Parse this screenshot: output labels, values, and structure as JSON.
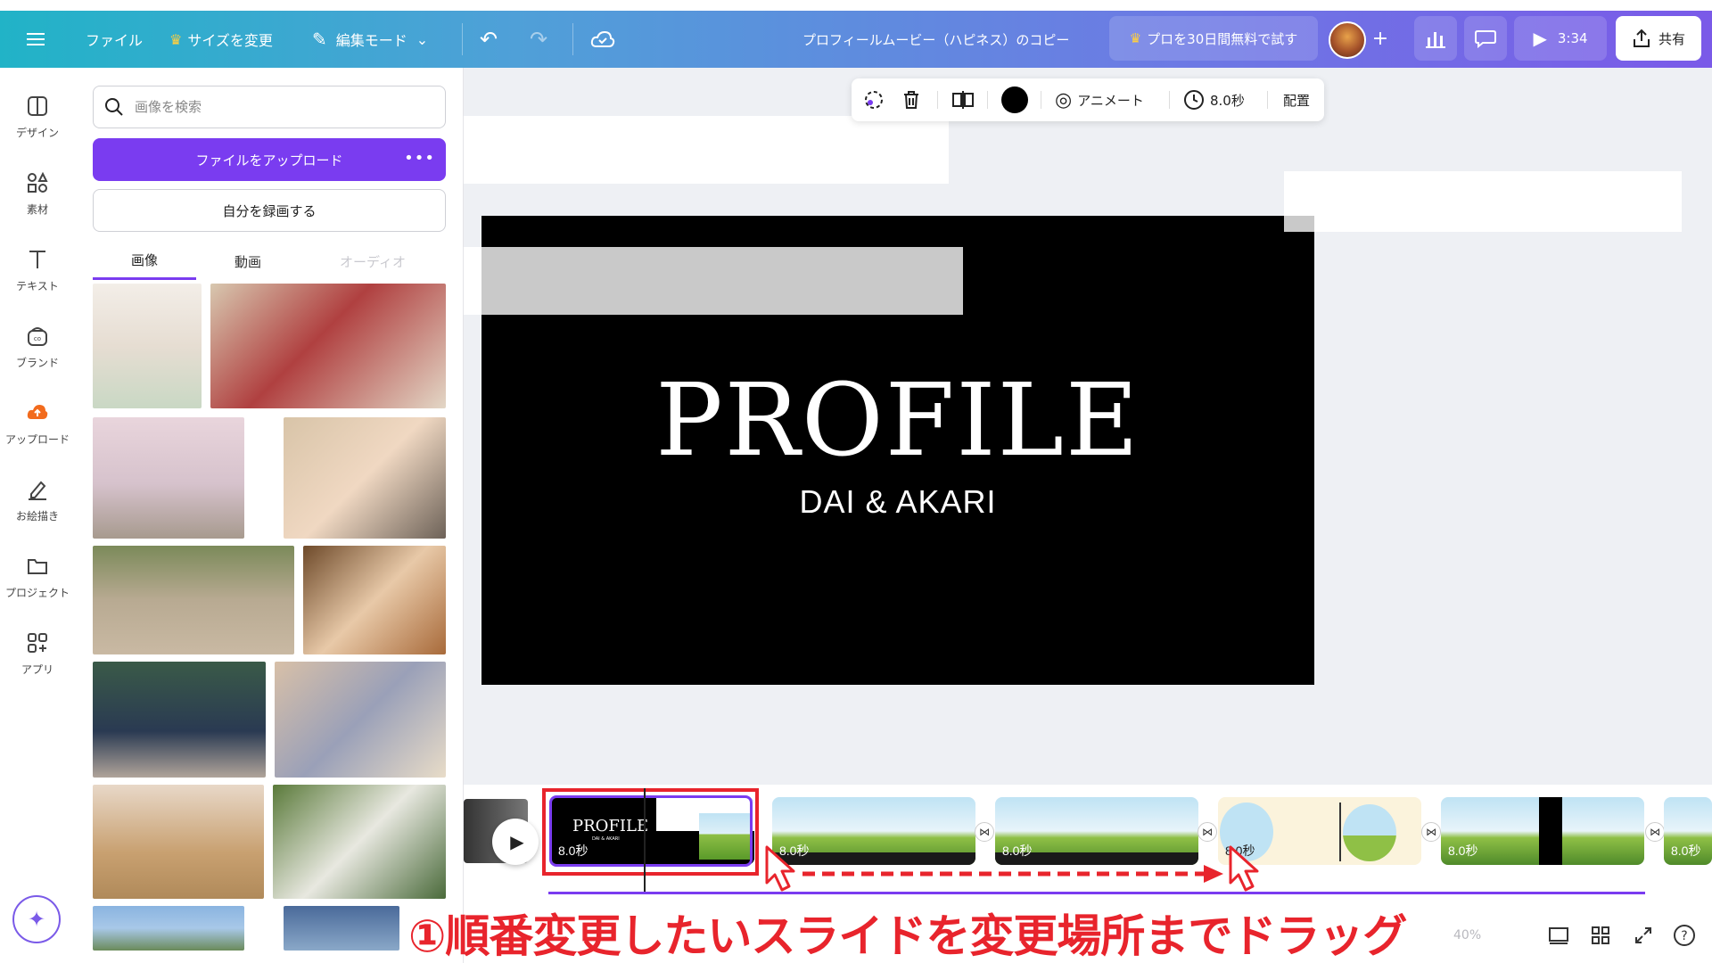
{
  "topbar": {
    "file": "ファイル",
    "resize": "サイズを変更",
    "edit_mode": "編集モード",
    "doc_title": "プロフィールムービー（ハピネス）のコピー",
    "pro_trial": "プロを30日間無料で試す",
    "play_time": "3:34",
    "share": "共有",
    "add": "+"
  },
  "rail": {
    "items": [
      {
        "label": "デザイン",
        "icon": "layout-icon"
      },
      {
        "label": "素材",
        "icon": "elements-icon"
      },
      {
        "label": "テキスト",
        "icon": "text-icon"
      },
      {
        "label": "ブランド",
        "icon": "brand-icon"
      },
      {
        "label": "アップロード",
        "icon": "upload-cloud-icon"
      },
      {
        "label": "お絵描き",
        "icon": "draw-icon"
      },
      {
        "label": "プロジェクト",
        "icon": "folder-icon"
      },
      {
        "label": "アプリ",
        "icon": "apps-icon"
      }
    ]
  },
  "panel": {
    "search_placeholder": "画像を検索",
    "upload_label": "ファイルをアップロード",
    "upload_more": "•••",
    "record_label": "自分を録画する",
    "tabs": [
      "画像",
      "動画",
      "オーディオ"
    ]
  },
  "context_bar": {
    "animate": "アニメート",
    "duration": "8.0秒",
    "arrange": "配置"
  },
  "slide": {
    "title": "PROFILE",
    "subtitle": "DAI & AKARI"
  },
  "timeline": {
    "clips": [
      {
        "duration": "8.0秒",
        "mini_title": "PROFILE",
        "mini_sub": "DAI & AKARI"
      },
      {
        "duration": "8.0秒"
      },
      {
        "duration": "8.0秒"
      },
      {
        "duration": "8.0秒"
      },
      {
        "duration": "8.0秒"
      },
      {
        "duration": "8.0秒"
      }
    ],
    "zoom": "40%"
  },
  "annotation": {
    "caption": "①順番変更したいスライドを変更場所までドラッグ"
  },
  "colors": {
    "accent": "#7a3cf0",
    "annotation_red": "#e8242c"
  }
}
